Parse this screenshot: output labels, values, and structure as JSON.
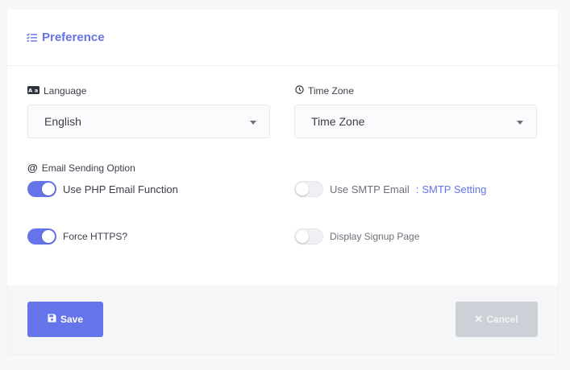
{
  "card": {
    "title": "Preference"
  },
  "language": {
    "label": "Language",
    "value": "English"
  },
  "timezone": {
    "label": "Time Zone",
    "value": "Time Zone"
  },
  "email": {
    "label": "Email Sending Option",
    "php_label": "Use PHP Email Function",
    "php_enabled": true,
    "smtp_label": "Use SMTP Email",
    "smtp_separator": ":",
    "smtp_link": "SMTP Setting",
    "smtp_enabled": false
  },
  "force_https": {
    "label": "Force HTTPS?",
    "enabled": true
  },
  "signup_page": {
    "label": "Display Signup Page",
    "enabled": false
  },
  "footer": {
    "save_label": "Save",
    "cancel_label": "Cancel"
  },
  "colors": {
    "accent": "#6674ea",
    "cancel_bg": "#cdd0d6"
  }
}
